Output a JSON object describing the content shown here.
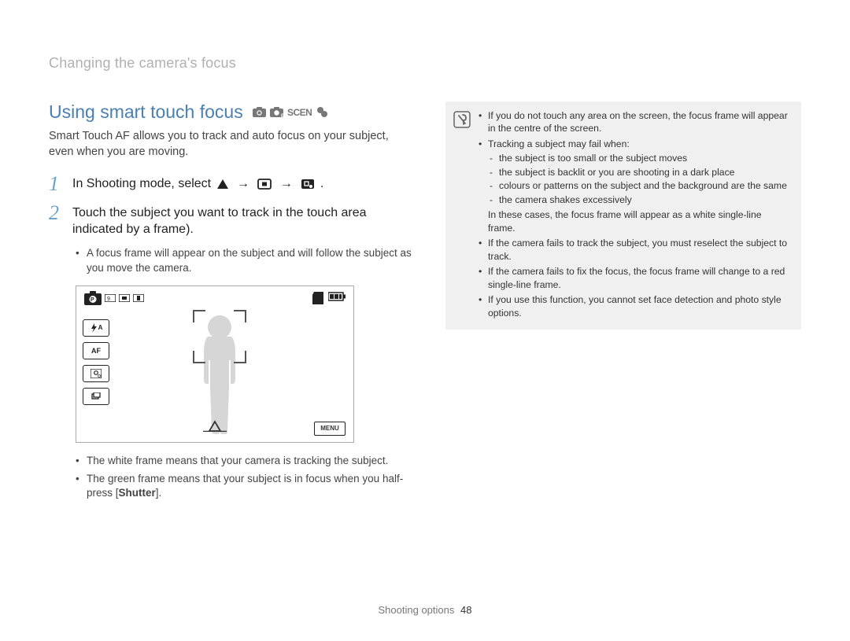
{
  "section_header": "Changing the camera's focus",
  "heading": "Using smart touch focus",
  "intro": "Smart Touch AF allows you to track and auto focus on your subject, even when you are moving.",
  "steps": {
    "s1": {
      "num": "1",
      "text_pre": "In Shooting mode, select ",
      "text_post": "."
    },
    "s2": {
      "num": "2",
      "text": "Touch the subject you want to track in the touch area indicated by a frame)."
    }
  },
  "sub1": "A focus frame will appear on the subject and will follow the subject as you move the camera.",
  "sub2": "The white frame means that your camera is tracking the subject.",
  "sub3_pre": "The green frame means that your subject is in focus when you half-press [",
  "sub3_bold": "Shutter",
  "sub3_post": "].",
  "vf": {
    "side1": "AF",
    "menu": "MENU"
  },
  "info": {
    "b1": "If you do not touch any area on the screen, the focus frame will appear in the centre of the screen.",
    "b2": "Tracking a subject may fail when:",
    "b2a": "the subject is too small or the subject moves",
    "b2b": "the subject is backlit or you are shooting in a dark place",
    "b2c": "colours or patterns on the subject and the background are the same",
    "b2d": "the camera shakes excessively",
    "b2_cont": "In these cases, the focus frame will appear as a white single-line frame.",
    "b3": "If the camera fails to track the subject, you must reselect the subject to track.",
    "b4": "If the camera fails to fix the focus, the focus frame will change to a red single-line frame.",
    "b5": "If you use this function, you cannot set face detection and photo style options."
  },
  "footer": {
    "section": "Shooting options",
    "page": "48"
  }
}
